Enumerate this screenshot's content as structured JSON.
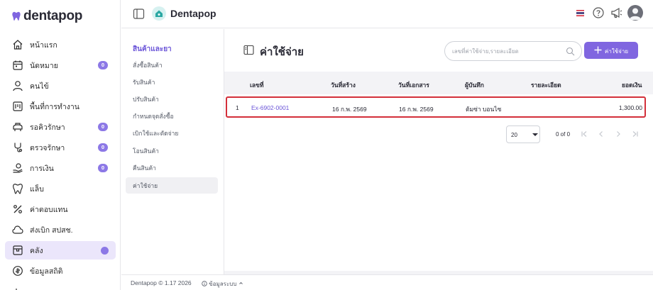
{
  "brand": {
    "name": "dentapop",
    "accent": "#8066e0",
    "logo_icon": "tooth-icon"
  },
  "nav": {
    "items": [
      {
        "label": "หน้าแรก",
        "icon": "home-icon"
      },
      {
        "label": "นัดหมาย",
        "icon": "calendar-icon",
        "badge": "0"
      },
      {
        "label": "คนไข้",
        "icon": "user-icon"
      },
      {
        "label": "พื้นที่การทำงาน",
        "icon": "workspace-icon"
      },
      {
        "label": "รอคิวรักษา",
        "icon": "waiting-icon",
        "badge": "0"
      },
      {
        "label": "ตรวจรักษา",
        "icon": "treatment-icon",
        "badge": "0"
      },
      {
        "label": "การเงิน",
        "icon": "finance-icon",
        "badge": "0"
      },
      {
        "label": "แล็บ",
        "icon": "lab-tooth-icon"
      },
      {
        "label": "ค่าตอบแทน",
        "icon": "percent-icon"
      },
      {
        "label": "ส่งเบิก สปสช.",
        "icon": "cloud-icon"
      },
      {
        "label": "คลัง",
        "icon": "inventory-box-icon",
        "active": true
      },
      {
        "label": "ข้อมูลสถิติ",
        "icon": "statistics-icon"
      }
    ]
  },
  "header": {
    "title": "Dentapop",
    "brand_icon": "home-badge-icon"
  },
  "submenu": {
    "heading": "สินค้าและยา",
    "items": [
      "สั่งซื้อสินค้า",
      "รับสินค้า",
      "ปรับสินค้า",
      "กำหนดจุดสั่งซื้อ",
      "เบิกใช้และตัดจ่าย",
      "โอนสินค้า",
      "คืนสินค้า",
      "ค่าใช้จ่าย"
    ],
    "active_index": 7
  },
  "main": {
    "title": "ค่าใช้จ่าย",
    "search_placeholder": "เลขที่ค่าใช้จ่าย,รายละเอียด",
    "add_button": "ค่าใช้จ่าย",
    "columns": [
      "เลขที่",
      "วันที่สร้าง",
      "วันที่เอกสาร",
      "ผู้บันทึก",
      "รายละเอียด",
      "ยอดเงิน"
    ],
    "rows": [
      {
        "index": "1",
        "number": "Ex-6902-0001",
        "created": "16 ก.พ. 2569",
        "doc_date": "16 ก.พ. 2569",
        "recorder": "ต้มซ่า บอนไซ",
        "detail": "",
        "amount": "1,300.00"
      }
    ],
    "pagination": {
      "page_size": "20",
      "range": "0 of 0"
    }
  },
  "footer": {
    "copyright": "Dentapop © 1.17 2026",
    "system_info": "ข้อมูลระบบ"
  }
}
